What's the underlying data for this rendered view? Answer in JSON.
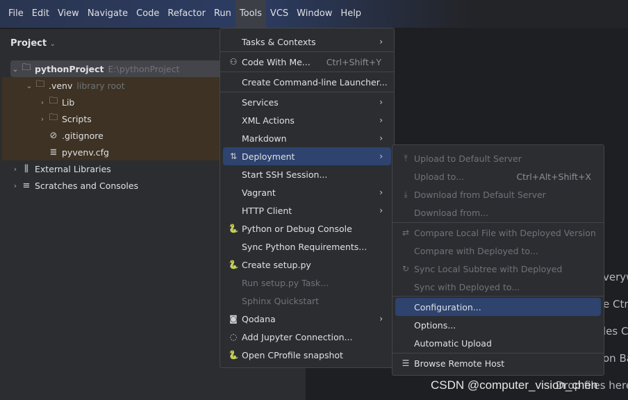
{
  "menubar": [
    "File",
    "Edit",
    "View",
    "Navigate",
    "Code",
    "Refactor",
    "Run",
    "Tools",
    "VCS",
    "Window",
    "Help"
  ],
  "project": {
    "title": "Project",
    "root": "pythonProject",
    "root_path": "E:\\pythonProject",
    "venv": ".venv",
    "venv_tag": "library root",
    "lib": "Lib",
    "scripts": "Scripts",
    "gitignore": ".gitignore",
    "cfg": "pyvenv.cfg",
    "ext": "External Libraries",
    "scratch": "Scratches and Consoles"
  },
  "tools_menu": [
    {
      "label": "Tasks & Contexts",
      "submenu": true
    },
    {
      "label": "Code With Me...",
      "shortcut": "Ctrl+Shift+Y",
      "icon": "user-add-icon"
    },
    {
      "label": "Create Command-line Launcher..."
    },
    {
      "label": "Services",
      "submenu": true
    },
    {
      "label": "XML Actions",
      "submenu": true
    },
    {
      "label": "Markdown",
      "submenu": true
    },
    {
      "label": "Deployment",
      "submenu": true,
      "icon": "deployment-icon",
      "selected": true
    },
    {
      "label": "Start SSH Session..."
    },
    {
      "label": "Vagrant",
      "submenu": true
    },
    {
      "label": "HTTP Client",
      "submenu": true
    },
    {
      "label": "Python or Debug Console",
      "icon": "python-icon"
    },
    {
      "label": "Sync Python Requirements..."
    },
    {
      "label": "Create setup.py",
      "icon": "python-icon"
    },
    {
      "label": "Run setup.py Task...",
      "disabled": true
    },
    {
      "label": "Sphinx Quickstart",
      "disabled": true
    },
    {
      "label": "Qodana",
      "submenu": true,
      "icon": "qodana-icon"
    },
    {
      "label": "Add Jupyter Connection...",
      "icon": "jupyter-icon"
    },
    {
      "label": "Open CProfile snapshot",
      "icon": "python-icon"
    }
  ],
  "deploy_menu": [
    {
      "label": "Upload to Default Server",
      "disabled": true,
      "icon": "upload-icon"
    },
    {
      "label": "Upload to...",
      "disabled": true,
      "shortcut": "Ctrl+Alt+Shift+X"
    },
    {
      "label": "Download from Default Server",
      "disabled": true,
      "icon": "download-icon"
    },
    {
      "label": "Download from...",
      "disabled": true
    },
    {
      "label": "Compare Local File with Deployed Version",
      "disabled": true,
      "icon": "compare-icon"
    },
    {
      "label": "Compare with Deployed to...",
      "disabled": true
    },
    {
      "label": "Sync Local Subtree with Deployed",
      "disabled": true,
      "icon": "sync-icon"
    },
    {
      "label": "Sync with Deployed to...",
      "disabled": true
    },
    {
      "label": "Configuration...",
      "selected": true
    },
    {
      "label": "Options..."
    },
    {
      "label": "Automatic Upload"
    },
    {
      "label": "Browse Remote Host",
      "icon": "server-icon"
    }
  ],
  "background_hints": [
    "verywh",
    "e  Ctr",
    "les  C",
    "on Ba",
    "Drop files here"
  ],
  "watermark": "CSDN @computer_vision_chen"
}
